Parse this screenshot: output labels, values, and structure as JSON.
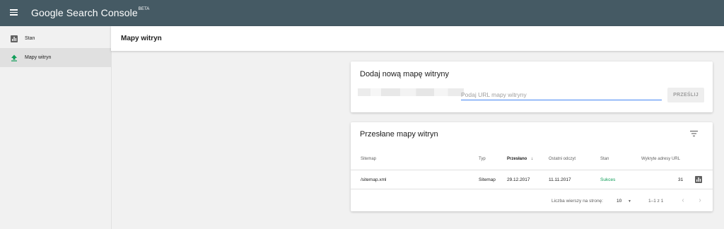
{
  "topbar": {
    "menu_icon": "menu-icon",
    "brand": "Google Search Console",
    "brand_badge": "BETA"
  },
  "sidebar": {
    "items": [
      {
        "label": "Stan",
        "icon": "bar-chart-icon",
        "active": false
      },
      {
        "label": "Mapy witryn",
        "icon": "upload-icon",
        "active": true
      }
    ]
  },
  "header": {
    "title": "Mapy witryn"
  },
  "add_sitemap": {
    "title": "Dodaj nową mapę witryny",
    "input_placeholder": "Podaj URL mapy witryny",
    "input_value": "",
    "submit_label": "PRZEŚLIJ"
  },
  "submitted": {
    "title": "Przesłane mapy witryn",
    "filter_icon": "filter-icon",
    "columns": [
      "Sitemap",
      "Typ",
      "Przesłano",
      "Ostatni odczyt",
      "Stan",
      "Wykryte adresy URL"
    ],
    "sorted_column": "Przesłano",
    "rows": [
      {
        "sitemap": "/sitemap.xml",
        "type": "Sitemap",
        "submitted": "29.12.2017",
        "last_read": "11.11.2017",
        "status": "Sukces",
        "urls": "31"
      }
    ],
    "footer": {
      "rows_per_page_label": "Liczba wierszy na stronę:",
      "rows_per_page_value": "10",
      "range": "1–1 z 1"
    }
  },
  "colors": {
    "topbar": "#455a64",
    "accent": "#4285f4",
    "success": "#0f9d58"
  }
}
